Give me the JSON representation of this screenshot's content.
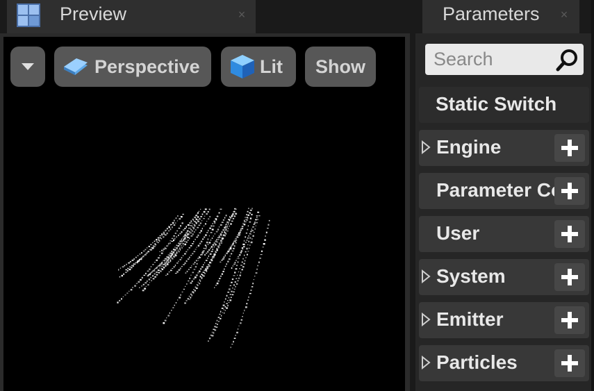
{
  "preview_tab": {
    "title": "Preview",
    "close": "×"
  },
  "viewport_toolbar": {
    "perspective_label": "Perspective",
    "lit_label": "Lit",
    "show_label": "Show"
  },
  "params_tab": {
    "title": "Parameters",
    "close": "×"
  },
  "search": {
    "placeholder": "Search"
  },
  "categories": [
    {
      "label": "Static Switch",
      "expandable": false,
      "addable": false
    },
    {
      "label": "Engine",
      "expandable": true,
      "addable": true
    },
    {
      "label": "Parameter Collection",
      "expandable": false,
      "addable": true
    },
    {
      "label": "User",
      "expandable": false,
      "addable": true
    },
    {
      "label": "System",
      "expandable": true,
      "addable": true
    },
    {
      "label": "Emitter",
      "expandable": true,
      "addable": true
    },
    {
      "label": "Particles",
      "expandable": true,
      "addable": true
    }
  ],
  "colors": {
    "panel_bg": "#262626",
    "row_bg": "#383838",
    "button_bg": "#575757",
    "viewport_bg": "#000000"
  }
}
